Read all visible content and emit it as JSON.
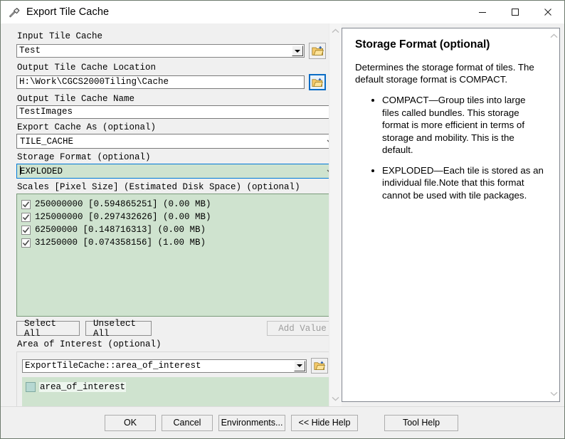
{
  "window": {
    "title": "Export Tile Cache",
    "icon": "hammer-tool-icon",
    "minimize": "─",
    "maximize": "□",
    "close": "✕"
  },
  "form": {
    "input_tile_cache": {
      "label": "Input Tile Cache",
      "value": "Test",
      "browse_icon": "open-folder-icon"
    },
    "output_location": {
      "label": "Output Tile Cache Location",
      "value": "H:\\Work\\CGCS2000Tiling\\Cache",
      "browse_icon": "open-folder-icon"
    },
    "output_name": {
      "label": "Output Tile Cache Name",
      "value": "TestImages"
    },
    "export_cache_as": {
      "label": "Export Cache As (optional)",
      "value": "TILE_CACHE"
    },
    "storage_format": {
      "label": "Storage Format (optional)",
      "value": "EXPLODED",
      "focused": true,
      "highlight_color": "#cfe3cf"
    },
    "scales": {
      "label": "Scales [Pixel Size] (Estimated Disk Space) (optional)",
      "items": [
        {
          "scale": "250000000",
          "pixel_size": "[0.594865251]",
          "disk_space": "(0.00 MB)",
          "checked": true
        },
        {
          "scale": "125000000",
          "pixel_size": "[0.297432626]",
          "disk_space": "(0.00 MB)",
          "checked": true
        },
        {
          "scale": "62500000",
          "pixel_size": "[0.148716313]",
          "disk_space": "(0.00 MB)",
          "checked": true
        },
        {
          "scale": "31250000",
          "pixel_size": "[0.074358156]",
          "disk_space": "(1.00 MB)",
          "checked": true
        }
      ]
    },
    "buttons": {
      "select_all": "Select All",
      "unselect_all": "Unselect All",
      "add_value": "Add Value",
      "add_value_disabled": true
    },
    "area_of_interest": {
      "label": "Area of Interest (optional)",
      "value": "ExportTileCache::area_of_interest",
      "browse_icon": "open-folder-icon",
      "list_items": [
        {
          "name": "area_of_interest",
          "swatch_color": "#b6d8d2"
        }
      ]
    }
  },
  "help": {
    "title": "Storage Format (optional)",
    "intro": "Determines the storage format of tiles. The default storage format is COMPACT.",
    "bullets": [
      "COMPACT—Group tiles into large files called bundles. This storage format is more efficient in terms of storage and mobility. This is the default.",
      "EXPLODED—Each tile is stored as an individual file.Note that this format cannot be used with tile packages."
    ]
  },
  "footer": {
    "ok": "OK",
    "cancel": "Cancel",
    "environments": "Environments...",
    "hide_help": "<< Hide Help",
    "tool_help": "Tool Help"
  }
}
